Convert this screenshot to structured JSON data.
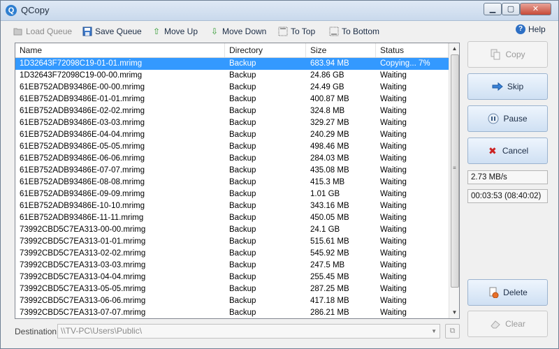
{
  "window": {
    "title": "QCopy",
    "controls": {
      "minimize": "▁",
      "maximize": "▢",
      "close": "✕"
    }
  },
  "toolbar": {
    "load_queue": "Load Queue",
    "save_queue": "Save Queue",
    "move_up": "Move Up",
    "move_down": "Move Down",
    "to_top": "To Top",
    "to_bottom": "To Bottom",
    "help": "Help"
  },
  "queue": {
    "columns": [
      "Name",
      "Directory",
      "Size",
      "Status"
    ],
    "rows": [
      {
        "name": "1D32643F72098C19-01-01.mrimg",
        "directory": "Backup",
        "size": "683.94 MB",
        "status": "Copying... 7%",
        "selected": true
      },
      {
        "name": "1D32643F72098C19-00-00.mrimg",
        "directory": "Backup",
        "size": "24.86 GB",
        "status": "Waiting"
      },
      {
        "name": "61EB752ADB93486E-00-00.mrimg",
        "directory": "Backup",
        "size": "24.49 GB",
        "status": "Waiting"
      },
      {
        "name": "61EB752ADB93486E-01-01.mrimg",
        "directory": "Backup",
        "size": "400.87 MB",
        "status": "Waiting"
      },
      {
        "name": "61EB752ADB93486E-02-02.mrimg",
        "directory": "Backup",
        "size": "324.8 MB",
        "status": "Waiting"
      },
      {
        "name": "61EB752ADB93486E-03-03.mrimg",
        "directory": "Backup",
        "size": "329.27 MB",
        "status": "Waiting"
      },
      {
        "name": "61EB752ADB93486E-04-04.mrimg",
        "directory": "Backup",
        "size": "240.29 MB",
        "status": "Waiting"
      },
      {
        "name": "61EB752ADB93486E-05-05.mrimg",
        "directory": "Backup",
        "size": "498.46 MB",
        "status": "Waiting"
      },
      {
        "name": "61EB752ADB93486E-06-06.mrimg",
        "directory": "Backup",
        "size": "284.03 MB",
        "status": "Waiting"
      },
      {
        "name": "61EB752ADB93486E-07-07.mrimg",
        "directory": "Backup",
        "size": "435.08 MB",
        "status": "Waiting"
      },
      {
        "name": "61EB752ADB93486E-08-08.mrimg",
        "directory": "Backup",
        "size": "415.3 MB",
        "status": "Waiting"
      },
      {
        "name": "61EB752ADB93486E-09-09.mrimg",
        "directory": "Backup",
        "size": "1.01 GB",
        "status": "Waiting"
      },
      {
        "name": "61EB752ADB93486E-10-10.mrimg",
        "directory": "Backup",
        "size": "343.16 MB",
        "status": "Waiting"
      },
      {
        "name": "61EB752ADB93486E-11-11.mrimg",
        "directory": "Backup",
        "size": "450.05 MB",
        "status": "Waiting"
      },
      {
        "name": "73992CBD5C7EA313-00-00.mrimg",
        "directory": "Backup",
        "size": "24.1 GB",
        "status": "Waiting"
      },
      {
        "name": "73992CBD5C7EA313-01-01.mrimg",
        "directory": "Backup",
        "size": "515.61 MB",
        "status": "Waiting"
      },
      {
        "name": "73992CBD5C7EA313-02-02.mrimg",
        "directory": "Backup",
        "size": "545.92 MB",
        "status": "Waiting"
      },
      {
        "name": "73992CBD5C7EA313-03-03.mrimg",
        "directory": "Backup",
        "size": "247.5 MB",
        "status": "Waiting"
      },
      {
        "name": "73992CBD5C7EA313-04-04.mrimg",
        "directory": "Backup",
        "size": "255.45 MB",
        "status": "Waiting"
      },
      {
        "name": "73992CBD5C7EA313-05-05.mrimg",
        "directory": "Backup",
        "size": "287.25 MB",
        "status": "Waiting"
      },
      {
        "name": "73992CBD5C7EA313-06-06.mrimg",
        "directory": "Backup",
        "size": "417.18 MB",
        "status": "Waiting"
      },
      {
        "name": "73992CBD5C7EA313-07-07.mrimg",
        "directory": "Backup",
        "size": "286.21 MB",
        "status": "Waiting"
      }
    ]
  },
  "actions": {
    "copy": "Copy",
    "skip": "Skip",
    "pause": "Pause",
    "cancel": "Cancel",
    "delete": "Delete",
    "clear": "Clear"
  },
  "stats": {
    "speed": "2.73 MB/s",
    "time": "00:03:53 (08:40:02)"
  },
  "destination": {
    "label": "Destination:",
    "value": "\\\\TV-PC\\Users\\Public\\"
  },
  "colors": {
    "selection": "#3399ff",
    "cancel_icon": "#cc2222",
    "accent": "#2d6fc4"
  },
  "icons": {
    "load_queue": "folder-open-icon",
    "save_queue": "floppy-icon",
    "move_up": "arrow-up-icon",
    "move_down": "arrow-down-icon",
    "to_top": "to-top-icon",
    "to_bottom": "to-bottom-icon",
    "help": "help-icon",
    "copy": "copy-icon",
    "skip": "skip-icon",
    "pause": "pause-icon",
    "cancel": "cancel-icon",
    "delete": "delete-icon",
    "clear": "eraser-icon"
  }
}
